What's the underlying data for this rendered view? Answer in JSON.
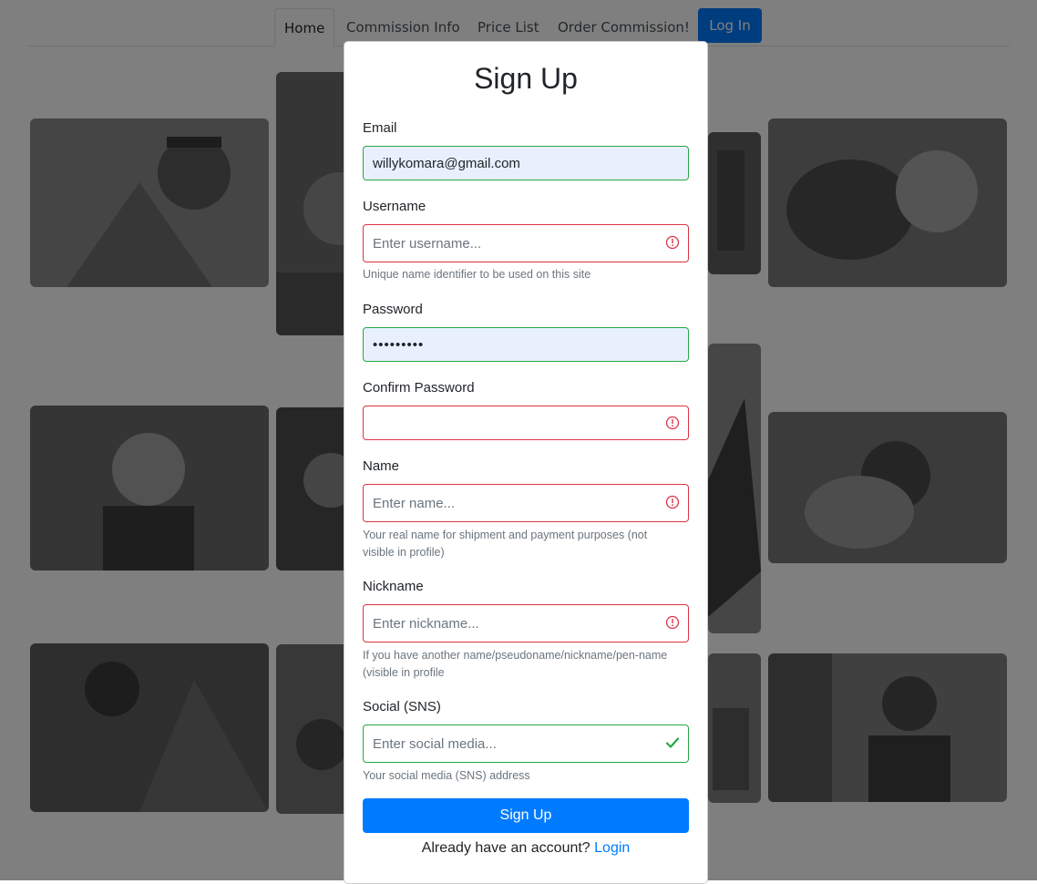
{
  "nav": {
    "tabs": [
      {
        "label": "Home"
      },
      {
        "label": "Commission Info"
      },
      {
        "label": "Price List"
      },
      {
        "label": "Order Commission!"
      }
    ],
    "login_button": "Log In"
  },
  "modal": {
    "title": "Sign Up",
    "fields": {
      "email": {
        "label": "Email",
        "value": "willykomara@gmail.com",
        "state": "valid"
      },
      "username": {
        "label": "Username",
        "placeholder": "Enter username...",
        "help": "Unique name identifier to be used on this site",
        "state": "invalid"
      },
      "password": {
        "label": "Password",
        "value": "•••••••••",
        "state": "valid"
      },
      "confirm_password": {
        "label": "Confirm Password",
        "placeholder": "",
        "state": "invalid"
      },
      "name": {
        "label": "Name",
        "placeholder": "Enter name...",
        "help": "Your real name for shipment and payment purposes (not visible in profile)",
        "state": "invalid"
      },
      "nickname": {
        "label": "Nickname",
        "placeholder": "Enter nickname...",
        "help": "If you have another name/pseudoname/nickname/pen-name (visible in profile",
        "state": "invalid"
      },
      "social": {
        "label": "Social (SNS)",
        "placeholder": "Enter social media...",
        "help": "Your social media (SNS) address",
        "state": "valid"
      }
    },
    "submit_label": "Sign Up",
    "footer_text": "Already have an account?",
    "footer_link": "Login"
  },
  "colors": {
    "primary": "#007bff",
    "valid": "#28a745",
    "invalid": "#dc3545",
    "autofill_bg": "#e8f0fe"
  }
}
